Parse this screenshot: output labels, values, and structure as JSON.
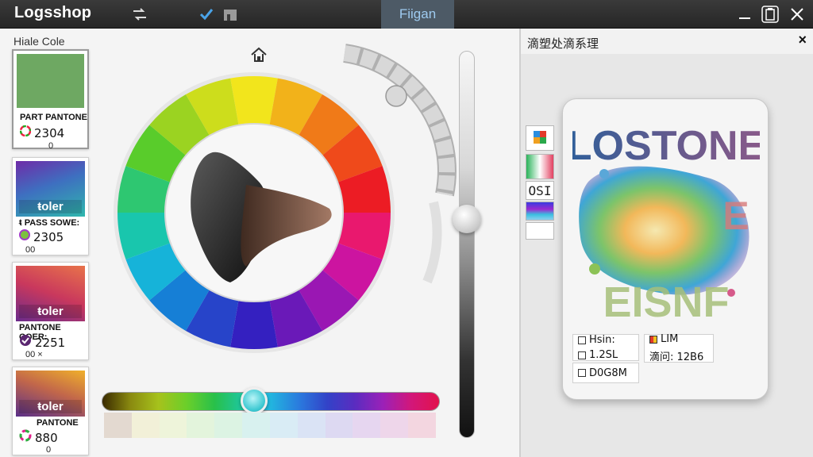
{
  "window": {
    "app_title": "Logsshop",
    "tab_label": "Fiigan",
    "accent": "#9ecbf0"
  },
  "icons": {
    "toolbar": [
      "swap-arrows-icon",
      "check-icon",
      "store-icon"
    ],
    "window_controls": [
      "minimize-icon",
      "clipboard-icon",
      "close-icon"
    ]
  },
  "left_panel": {
    "label": "Hiale Cole",
    "swatches": [
      {
        "color_text": "",
        "name": "PART PANTONE",
        "code": "2304",
        "foot": "0",
        "gradient": "#6ea862"
      },
      {
        "color_text": "ŧoler",
        "name": "ᵵ PASS SOWE:",
        "code": "2305",
        "foot": "00",
        "gradient": "linear-gradient(160deg,#6f2ba8,#3e6fc0 45%,#2fb7ad 100%)"
      },
      {
        "color_text": "ŧoler",
        "name": "PANTONE COER:",
        "code": "2251",
        "foot": "00   ×",
        "gradient": "linear-gradient(200deg,#e8734a,#c9385d 50%,#6b2b8c 100%)"
      },
      {
        "color_text": "ŧoler",
        "name": "PANTONE",
        "code": "880",
        "foot": "0",
        "gradient": "linear-gradient(200deg,#f0b02b,#c2674a 45%,#5a2f88 100%)"
      }
    ]
  },
  "wheel": {
    "segments": [
      "#f2e51c",
      "#f2b21a",
      "#f07a18",
      "#ef4a1b",
      "#ec1c24",
      "#e9186e",
      "#cc14a0",
      "#9a17b3",
      "#6a19b8",
      "#3420c0",
      "#2744c9",
      "#167fd6",
      "#16b3d9",
      "#19c6ad",
      "#2ec771",
      "#59cc2b",
      "#9bd321",
      "#cddd1c"
    ],
    "hue_selected": "#3dc9d2"
  },
  "hue_tints": [
    "#e3d9d0",
    "#f2f0d8",
    "#eef4da",
    "#e3f4dc",
    "#dcf3e3",
    "#d8f1ef",
    "#d9ecf5",
    "#dae3f5",
    "#ddd9f2",
    "#e6d6f0",
    "#eed6ea",
    "#f3d6e0"
  ],
  "right_panel": {
    "title": "滴塑处滴系理",
    "close": "×",
    "tools": [
      "palette-icon",
      "gradient-icon",
      "OSI",
      "spectrum-icon",
      "blank-swatch"
    ],
    "preview": {
      "line1": "LOSTONE",
      "line2": "E",
      "line3": "EISNF"
    },
    "info": {
      "left_row1": "Hsin:",
      "left_row2": "1.2SL",
      "left_row3": "D0G8M",
      "right_row1": "LIM",
      "right_row2": "滴问: 12В6"
    }
  }
}
